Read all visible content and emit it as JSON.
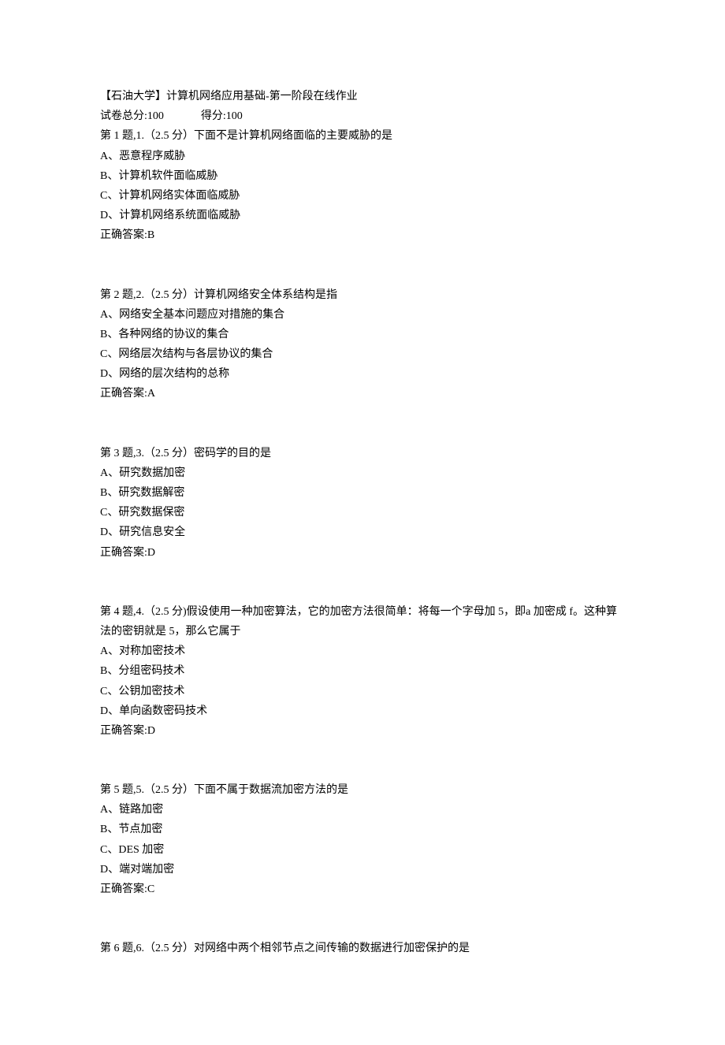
{
  "header": {
    "title": "【石油大学】计算机网络应用基础-第一阶段在线作业",
    "total_score_label": "试卷总分:100",
    "score_label": "得分:100"
  },
  "questions": [
    {
      "header": "第 1 题,1.（2.5 分）下面不是计算机网络面临的主要威胁的是",
      "options": [
        "A、恶意程序威胁",
        "B、计算机软件面临威胁",
        "C、计算机网络实体面临威胁",
        "D、计算机网络系统面临威胁"
      ],
      "answer": "正确答案:B"
    },
    {
      "header": "第 2 题,2.（2.5 分）计算机网络安全体系结构是指",
      "options": [
        "A、网络安全基本问题应对措施的集合",
        "B、各种网络的协议的集合",
        "C、网络层次结构与各层协议的集合",
        "D、网络的层次结构的总称"
      ],
      "answer": "正确答案:A"
    },
    {
      "header": "第 3 题,3.（2.5 分）密码学的目的是",
      "options": [
        "A、研究数据加密",
        "B、研究数据解密",
        "C、研究数据保密",
        "D、研究信息安全"
      ],
      "answer": "正确答案:D"
    },
    {
      "header": "第 4 题,4.（2.5 分)假设使用一种加密算法，它的加密方法很简单：将每一个字母加 5，即a 加密成 f。这种算法的密钥就是 5，那么它属于",
      "options": [
        "A、对称加密技术",
        "B、分组密码技术",
        "C、公钥加密技术",
        "D、单向函数密码技术"
      ],
      "answer": "正确答案:D"
    },
    {
      "header": "第 5 题,5.（2.5 分）下面不属于数据流加密方法的是",
      "options": [
        "A、链路加密",
        "B、节点加密",
        "C、DES 加密",
        "D、端对端加密"
      ],
      "answer": "正确答案:C"
    },
    {
      "header": "第 6 题,6.（2.5 分）对网络中两个相邻节点之间传输的数据进行加密保护的是",
      "options": [],
      "answer": ""
    }
  ]
}
